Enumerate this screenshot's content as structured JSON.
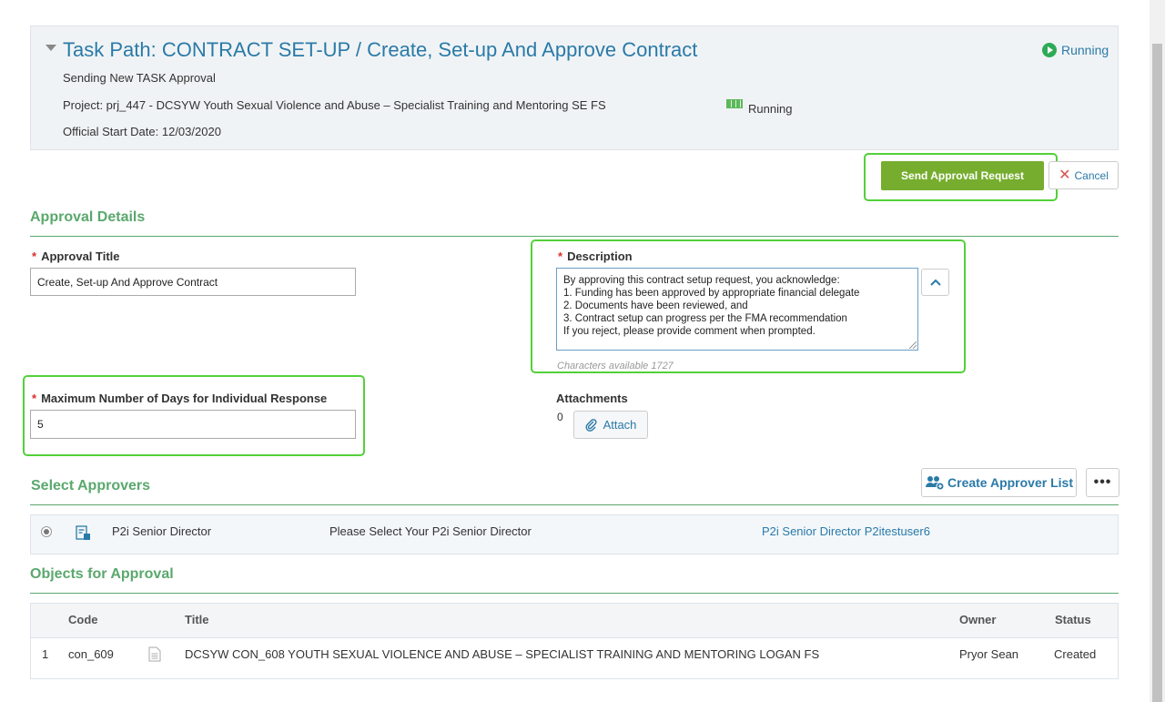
{
  "header": {
    "task_path": "Task Path: CONTRACT SET-UP / Create, Set-up And Approve Contract",
    "subtitle": "Sending New TASK Approval",
    "project": "Project: prj_447 - DCSYW Youth Sexual Violence and Abuse – Specialist Training and Mentoring SE FS",
    "project_status": "Running",
    "start_date": "Official Start Date: 12/03/2020",
    "status": "Running"
  },
  "actions": {
    "send_label": "Send Approval Request",
    "cancel_label": "Cancel"
  },
  "approval_details": {
    "section_title": "Approval Details",
    "approval_title_label": "Approval Title",
    "approval_title_value": "Create, Set-up And Approve Contract",
    "description_label": "Description",
    "description_lines": [
      "By approving this contract setup request, you acknowledge:",
      "1. Funding has been approved by appropriate financial delegate",
      "2. Documents have been reviewed, and",
      "3. Contract setup can progress per the FMA recommendation",
      "If you reject, please provide comment when prompted."
    ],
    "characters_available": "Characters available 1727",
    "max_days_label": "Maximum Number of Days for Individual Response",
    "max_days_value": "5",
    "attachments_label": "Attachments",
    "attachments_count": "0",
    "attach_label": "Attach"
  },
  "approvers": {
    "section_title": "Select Approvers",
    "create_list_label": "Create Approver List",
    "more_label": "•••",
    "row": {
      "role": "P2i Senior Director",
      "instruction": "Please Select Your P2i Senior Director",
      "assignee": "P2i Senior Director P2itestuser6"
    }
  },
  "objects": {
    "section_title": "Objects for Approval",
    "columns": [
      "Code",
      "Title",
      "Owner",
      "Status"
    ],
    "rows": [
      {
        "index": "1",
        "code": "con_609",
        "title": "DCSYW CON_608 YOUTH SEXUAL VIOLENCE AND ABUSE – SPECIALIST TRAINING AND MENTORING LOGAN FS",
        "owner": "Pryor Sean",
        "status": "Created"
      }
    ]
  },
  "colors": {
    "accent_green": "#5aa86d",
    "button_green": "#76ad2e",
    "link_blue": "#2a7aa8",
    "highlight": "#52d13a"
  }
}
